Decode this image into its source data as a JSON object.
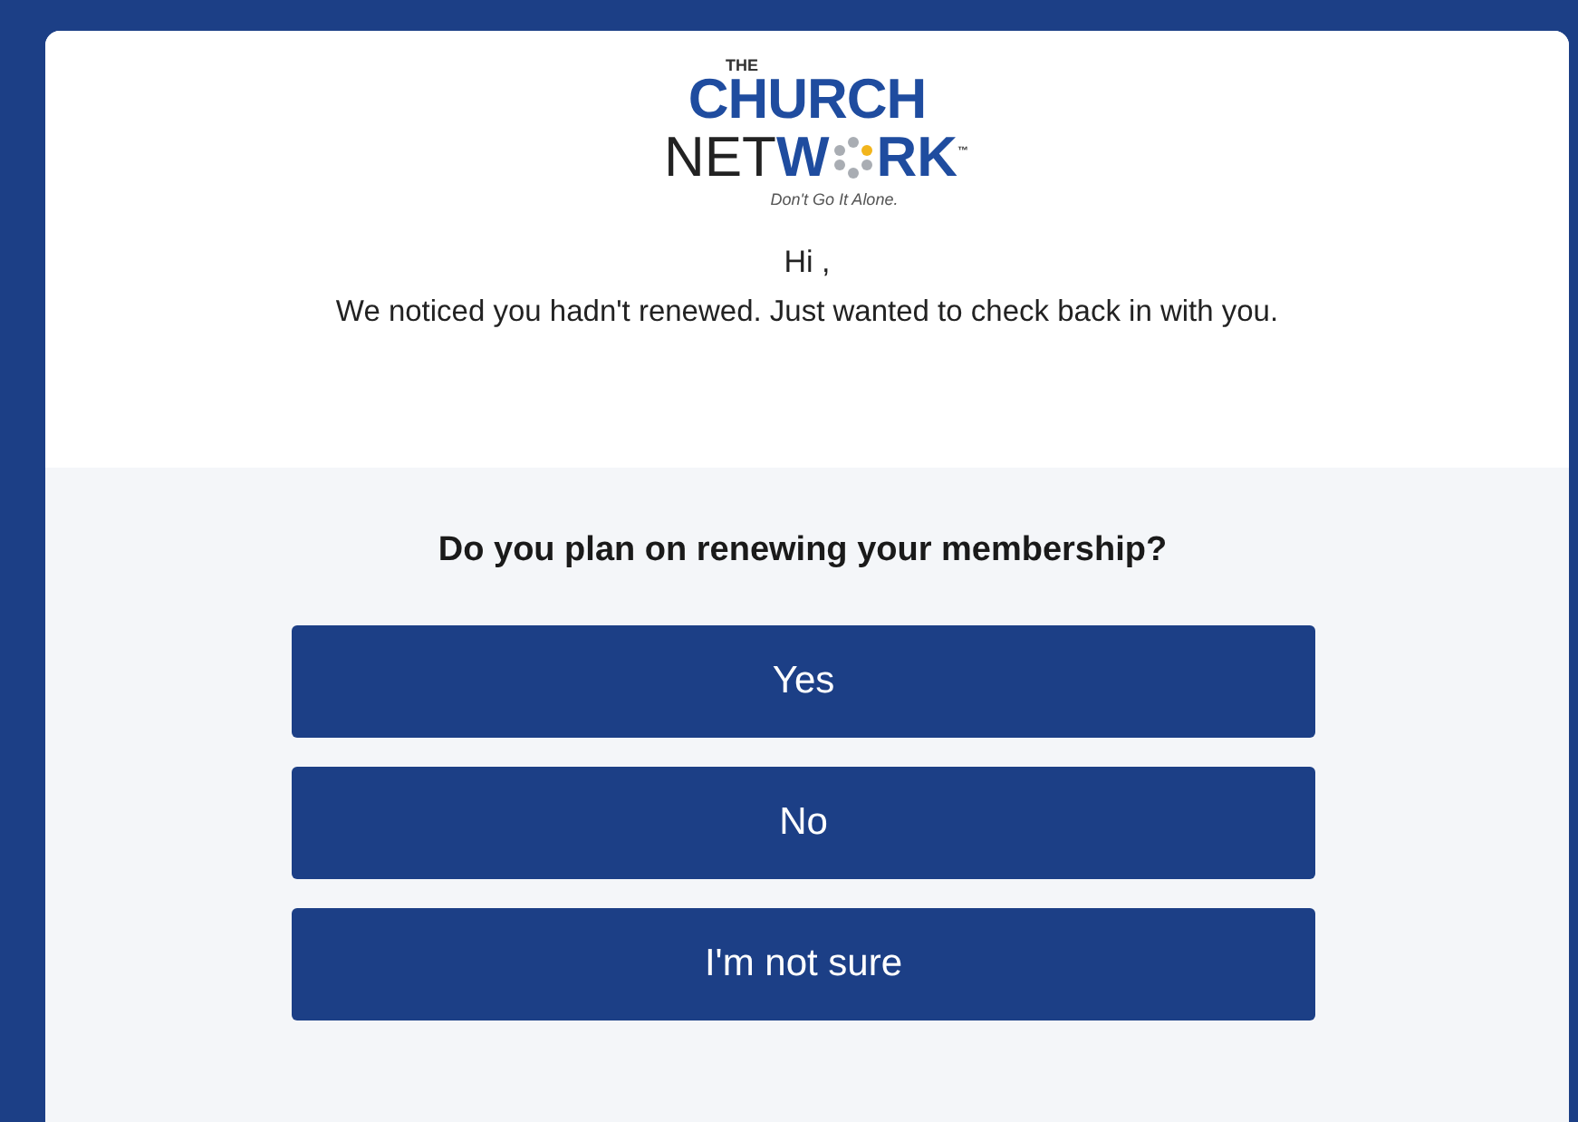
{
  "logo": {
    "top": "THE",
    "line1": "CHURCH",
    "line2": [
      {
        "text": "NET",
        "kind": "dark"
      },
      {
        "text": "W",
        "kind": "blue"
      },
      {
        "kind": "dots"
      },
      {
        "text": "RK",
        "kind": "blue"
      }
    ],
    "trademark": "™",
    "tagline": "Don't Go It Alone."
  },
  "greeting": "Hi ,",
  "message": "We noticed you hadn't renewed. Just wanted to check back in with you.",
  "question": "Do you plan on renewing your membership?",
  "buttons": [
    "Yes",
    "No",
    "I'm not sure"
  ]
}
